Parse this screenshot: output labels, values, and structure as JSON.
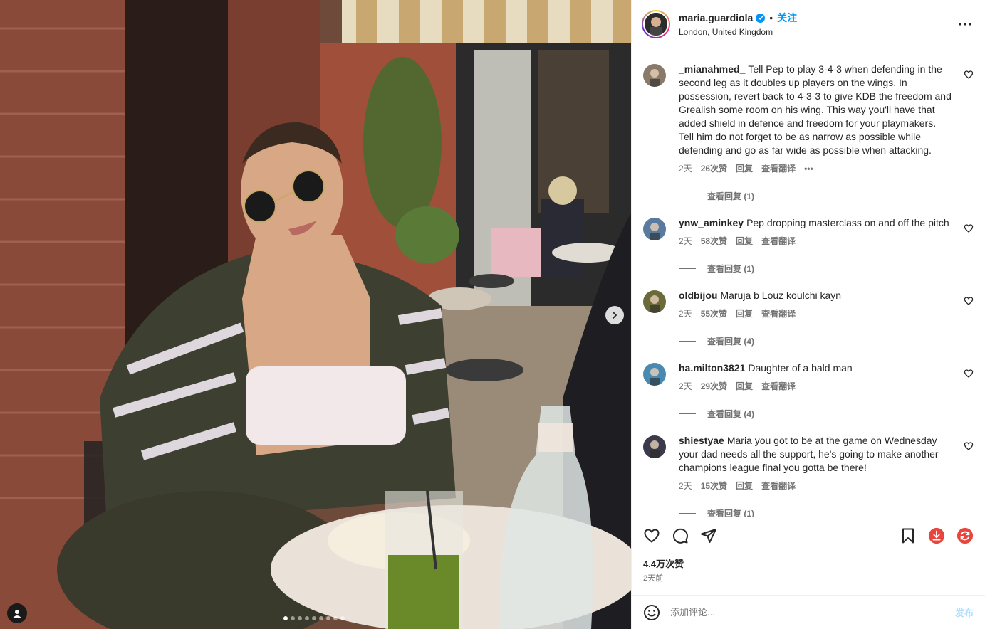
{
  "post": {
    "username": "maria.guardiola",
    "follow_label": "关注",
    "separator": "•",
    "location": "London, United Kingdom",
    "likes": "4.4万次赞",
    "time": "2天前"
  },
  "carousel": {
    "count": 9,
    "active": 0
  },
  "comments": [
    {
      "user": "_mianahmed_",
      "text": "Tell Pep to play 3-4-3 when defending in the second leg as it doubles up players on the wings. In possession, revert back to 4-3-3 to give KDB the freedom and Grealish some room on his wing. This way you'll have that added shield in defence and freedom for your playmakers. Tell him do not forget to be as narrow as possible while defending and go as far wide as possible when attacking.",
      "time": "2天",
      "likes": "26次赞",
      "reply": "回复",
      "translate": "查看翻译",
      "more": "•••",
      "replies": "查看回复 (1)",
      "avatar_color": "#8a7a6a"
    },
    {
      "user": "ynw_aminkey",
      "text": "Pep dropping masterclass on and off the pitch",
      "time": "2天",
      "likes": "58次赞",
      "reply": "回复",
      "translate": "查看翻译",
      "replies": "查看回复 (1)",
      "avatar_color": "#5a7aa0"
    },
    {
      "user": "oldbijou",
      "text": "Maruja b Louz koulchi kayn",
      "time": "2天",
      "likes": "55次赞",
      "reply": "回复",
      "translate": "查看翻译",
      "replies": "查看回复 (4)",
      "avatar_color": "#6b6a3a"
    },
    {
      "user": "ha.milton3821",
      "text": "Daughter of a bald man",
      "time": "2天",
      "likes": "29次赞",
      "reply": "回复",
      "translate": "查看翻译",
      "replies": "查看回复 (4)",
      "avatar_color": "#4a8ab0"
    },
    {
      "user": "shiestyae",
      "text": "Maria you got to be at the game on Wednesday your dad needs all the support, he's going to make another champions league final you gotta be there!",
      "time": "2天",
      "likes": "15次赞",
      "reply": "回复",
      "translate": "查看翻译",
      "replies": "查看回复 (1)",
      "avatar_color": "#3a3a4a"
    }
  ],
  "comment_box": {
    "placeholder": "添加评论...",
    "post_label": "发布"
  },
  "icons": [
    "more-icon",
    "heart-icon",
    "comment-icon",
    "share-icon",
    "bookmark-icon",
    "download-icon",
    "refresh-icon",
    "emoji-icon",
    "chevron-right-icon",
    "user-tag-icon",
    "verified-icon"
  ],
  "colors": {
    "accent": "#0095f6",
    "post_disabled": "#b2dffc",
    "muted": "#737373",
    "download": "#e8453c",
    "refresh": "#e8453c"
  }
}
